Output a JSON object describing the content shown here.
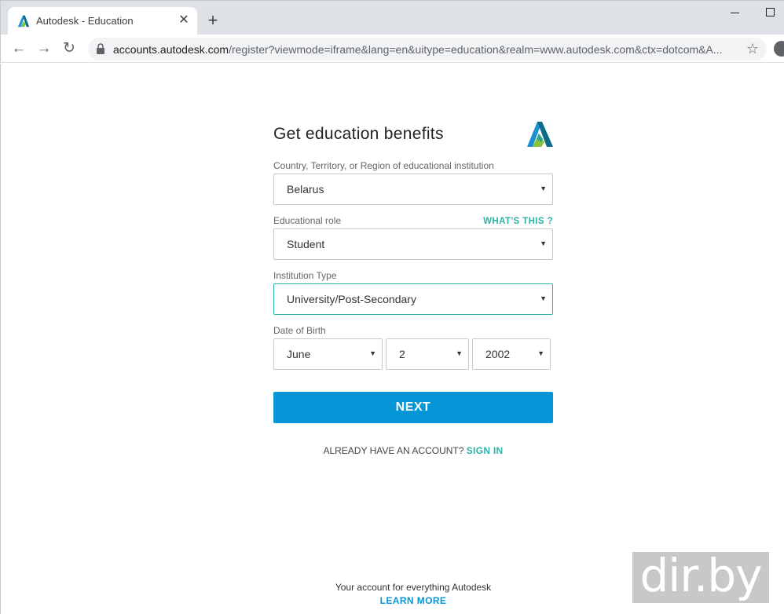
{
  "browser": {
    "tab_title": "Autodesk - Education",
    "new_tab_symbol": "+",
    "url_host": "accounts.autodesk.com",
    "url_path": "/register?viewmode=iframe&lang=en&uitype=education&realm=www.autodesk.com&ctx=dotcom&A..."
  },
  "form": {
    "heading": "Get education benefits",
    "country": {
      "label": "Country, Territory, or Region of educational institution",
      "value": "Belarus"
    },
    "role": {
      "label": "Educational role",
      "value": "Student",
      "help_link": "WHAT'S THIS ?"
    },
    "institution": {
      "label": "Institution Type",
      "value": "University/Post-Secondary"
    },
    "dob": {
      "label": "Date of Birth",
      "month": "June",
      "day": "2",
      "year": "2002"
    },
    "next_label": "NEXT",
    "account_prompt": "ALREADY HAVE AN ACCOUNT?",
    "sign_in_label": "SIGN IN"
  },
  "footer": {
    "text": "Your account for everything Autodesk",
    "learn_more": "LEARN MORE"
  },
  "watermark": "dir.by",
  "colors": {
    "primary": "#0696d7",
    "accent": "#2bb4a6"
  }
}
